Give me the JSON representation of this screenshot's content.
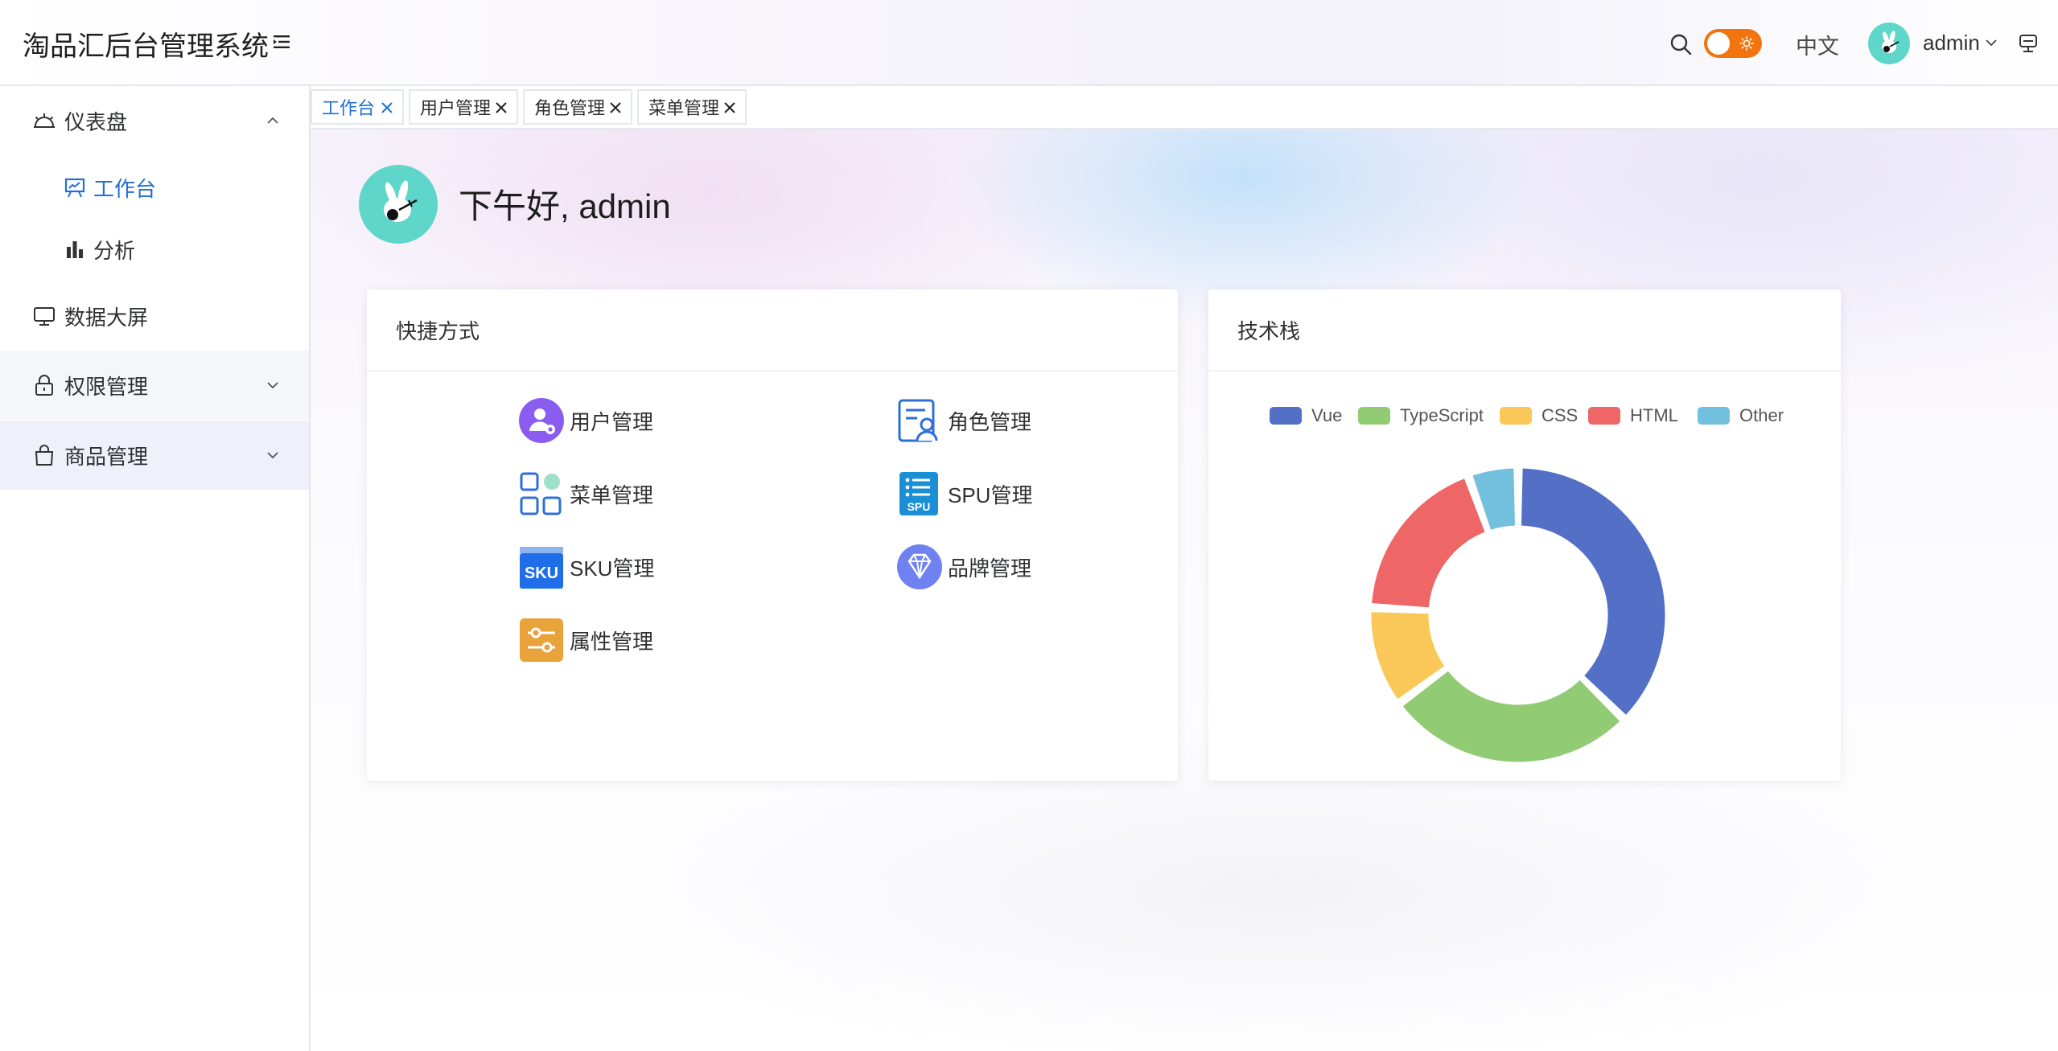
{
  "header": {
    "app_title": "淘品汇后台管理系统",
    "language": "中文",
    "username": "admin",
    "theme_toggle_accent": "#f1740e"
  },
  "sidebar": {
    "items": [
      {
        "label": "仪表盘",
        "icon": "dashboard-icon",
        "expanded": true
      },
      {
        "label": "工作台",
        "icon": "presentation-board-icon",
        "active": true
      },
      {
        "label": "分析",
        "icon": "bar-chart-icon"
      },
      {
        "label": "数据大屏",
        "icon": "monitor-icon"
      },
      {
        "label": "权限管理",
        "icon": "lock-icon",
        "expanded": false
      },
      {
        "label": "商品管理",
        "icon": "shopping-bag-icon",
        "expanded": false
      }
    ]
  },
  "tabs": [
    {
      "label": "工作台",
      "active": true
    },
    {
      "label": "用户管理"
    },
    {
      "label": "角色管理"
    },
    {
      "label": "菜单管理"
    }
  ],
  "main": {
    "greeting": "下午好, admin"
  },
  "shortcuts": {
    "title": "快捷方式",
    "items": [
      {
        "label": "用户管理",
        "icon": "user-settings-icon"
      },
      {
        "label": "角色管理",
        "icon": "role-card-icon"
      },
      {
        "label": "菜单管理",
        "icon": "menu-grid-icon"
      },
      {
        "label": "SPU管理",
        "icon": "spu-list-icon"
      },
      {
        "label": "SKU管理",
        "icon": "sku-box-icon"
      },
      {
        "label": "品牌管理",
        "icon": "diamond-icon"
      },
      {
        "label": "属性管理",
        "icon": "sliders-icon"
      }
    ]
  },
  "tech_stack": {
    "title": "技术栈"
  },
  "chart_data": {
    "type": "pie",
    "subtype": "donut",
    "categories": [
      "Vue",
      "TypeScript",
      "CSS",
      "HTML",
      "Other"
    ],
    "values": [
      34,
      25,
      10,
      17,
      5
    ],
    "colors": [
      "#5470c6",
      "#91cc75",
      "#fac858",
      "#ee6666",
      "#73c0de"
    ],
    "legend_position": "top",
    "title": ""
  }
}
